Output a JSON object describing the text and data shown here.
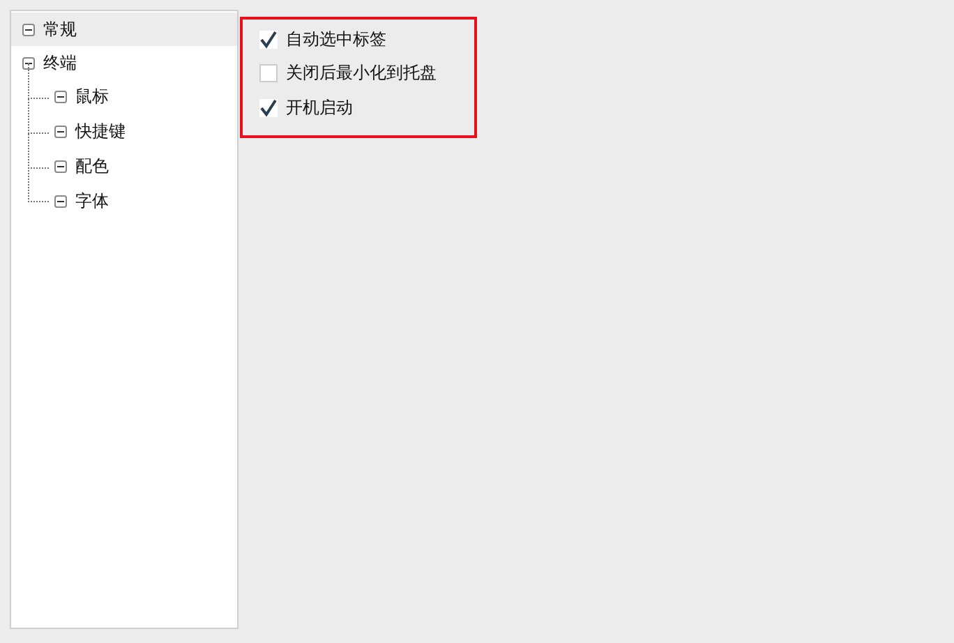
{
  "tree": [
    {
      "label": "常规",
      "expanded": true,
      "selected": true
    },
    {
      "label": "终端",
      "expanded": true,
      "selected": false,
      "children": [
        {
          "label": "鼠标",
          "expanded": true,
          "selected": false
        },
        {
          "label": "快捷键",
          "expanded": true,
          "selected": false
        },
        {
          "label": "配色",
          "expanded": true,
          "selected": false
        },
        {
          "label": "字体",
          "expanded": true,
          "selected": false
        }
      ]
    }
  ],
  "options": [
    {
      "label": "自动选中标签",
      "checked": true
    },
    {
      "label": "关闭后最小化到托盘",
      "checked": false
    },
    {
      "label": "开机启动",
      "checked": true
    }
  ]
}
